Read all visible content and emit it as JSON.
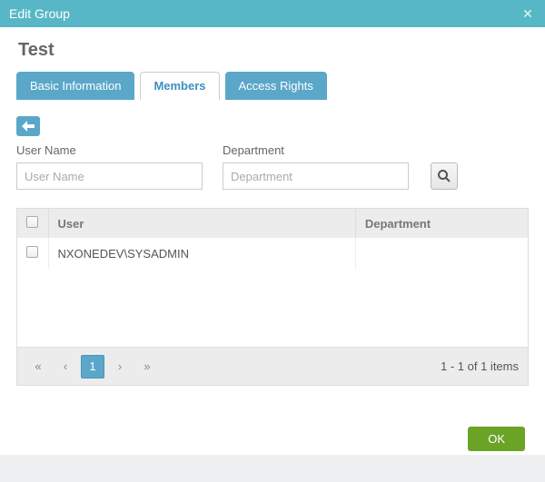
{
  "titlebar": {
    "title": "Edit Group"
  },
  "group": {
    "name": "Test"
  },
  "tabs": [
    {
      "label": "Basic Information",
      "active": false
    },
    {
      "label": "Members",
      "active": true
    },
    {
      "label": "Access Rights",
      "active": false
    }
  ],
  "filters": {
    "username": {
      "label": "User Name",
      "placeholder": "User Name",
      "value": ""
    },
    "department": {
      "label": "Department",
      "placeholder": "Department",
      "value": ""
    }
  },
  "table": {
    "columns": {
      "user": "User",
      "department": "Department"
    },
    "rows": [
      {
        "user": "NXONEDEV\\SYSADMIN",
        "department": ""
      }
    ]
  },
  "pager": {
    "page": "1",
    "status": "1 - 1 of 1 items"
  },
  "buttons": {
    "ok": "OK"
  }
}
